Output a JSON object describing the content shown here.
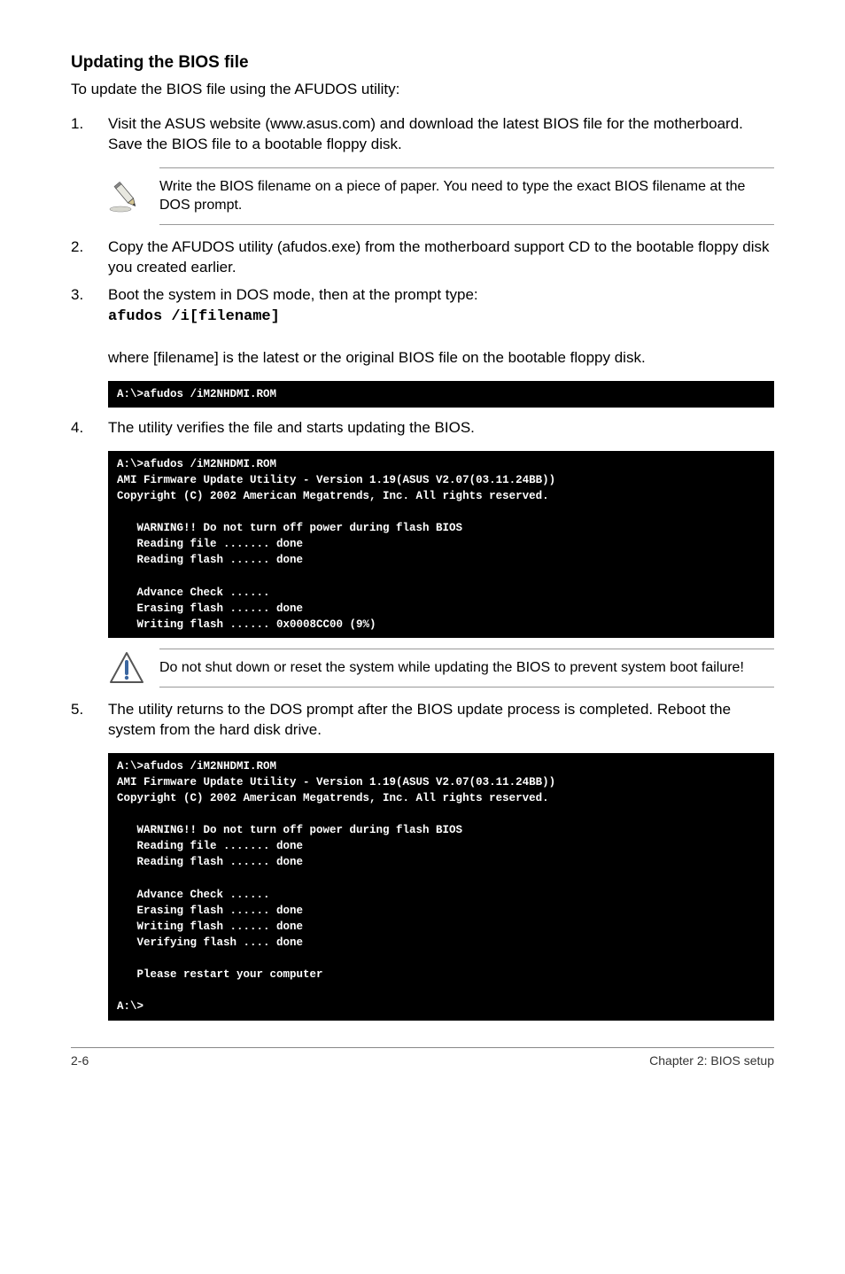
{
  "heading": "Updating the BIOS file",
  "intro": "To update the BIOS file using the AFUDOS utility:",
  "steps": {
    "s1": {
      "num": "1.",
      "text": "Visit the ASUS website (www.asus.com) and download the latest BIOS file for the motherboard. Save the BIOS file to a bootable floppy disk."
    },
    "note1": "Write the BIOS filename on a piece of paper. You need to type the exact BIOS filename at the DOS prompt.",
    "s2": {
      "num": "2.",
      "text": "Copy the AFUDOS utility (afudos.exe) from the motherboard support CD to the bootable floppy disk you created earlier."
    },
    "s3": {
      "num": "3.",
      "text": "Boot the system in DOS mode, then at the prompt type:",
      "cmd": "afudos /i[filename]",
      "after": "where [filename] is the latest or the original BIOS file on the bootable floppy disk."
    },
    "term1": "A:\\>afudos /iM2NHDMI.ROM",
    "s4": {
      "num": "4.",
      "text": "The utility verifies the file and starts updating the BIOS."
    },
    "term2": "A:\\>afudos /iM2NHDMI.ROM\nAMI Firmware Update Utility - Version 1.19(ASUS V2.07(03.11.24BB))\nCopyright (C) 2002 American Megatrends, Inc. All rights reserved.\n\n   WARNING!! Do not turn off power during flash BIOS\n   Reading file ....... done\n   Reading flash ...... done\n\n   Advance Check ......\n   Erasing flash ...... done\n   Writing flash ...... 0x0008CC00 (9%)",
    "warn": "Do not shut down or reset the system while updating the BIOS to prevent system boot failure!",
    "s5": {
      "num": "5.",
      "text": "The utility returns to the DOS prompt after the BIOS update process is completed. Reboot the system from the hard disk drive."
    },
    "term3": "A:\\>afudos /iM2NHDMI.ROM\nAMI Firmware Update Utility - Version 1.19(ASUS V2.07(03.11.24BB))\nCopyright (C) 2002 American Megatrends, Inc. All rights reserved.\n\n   WARNING!! Do not turn off power during flash BIOS\n   Reading file ....... done\n   Reading flash ...... done\n\n   Advance Check ......\n   Erasing flash ...... done\n   Writing flash ...... done\n   Verifying flash .... done\n\n   Please restart your computer\n\nA:\\>"
  },
  "footer": {
    "left": "2-6",
    "right": "Chapter 2: BIOS setup"
  },
  "icons": {
    "pencil": "pencil-icon",
    "warning": "warning-icon"
  }
}
